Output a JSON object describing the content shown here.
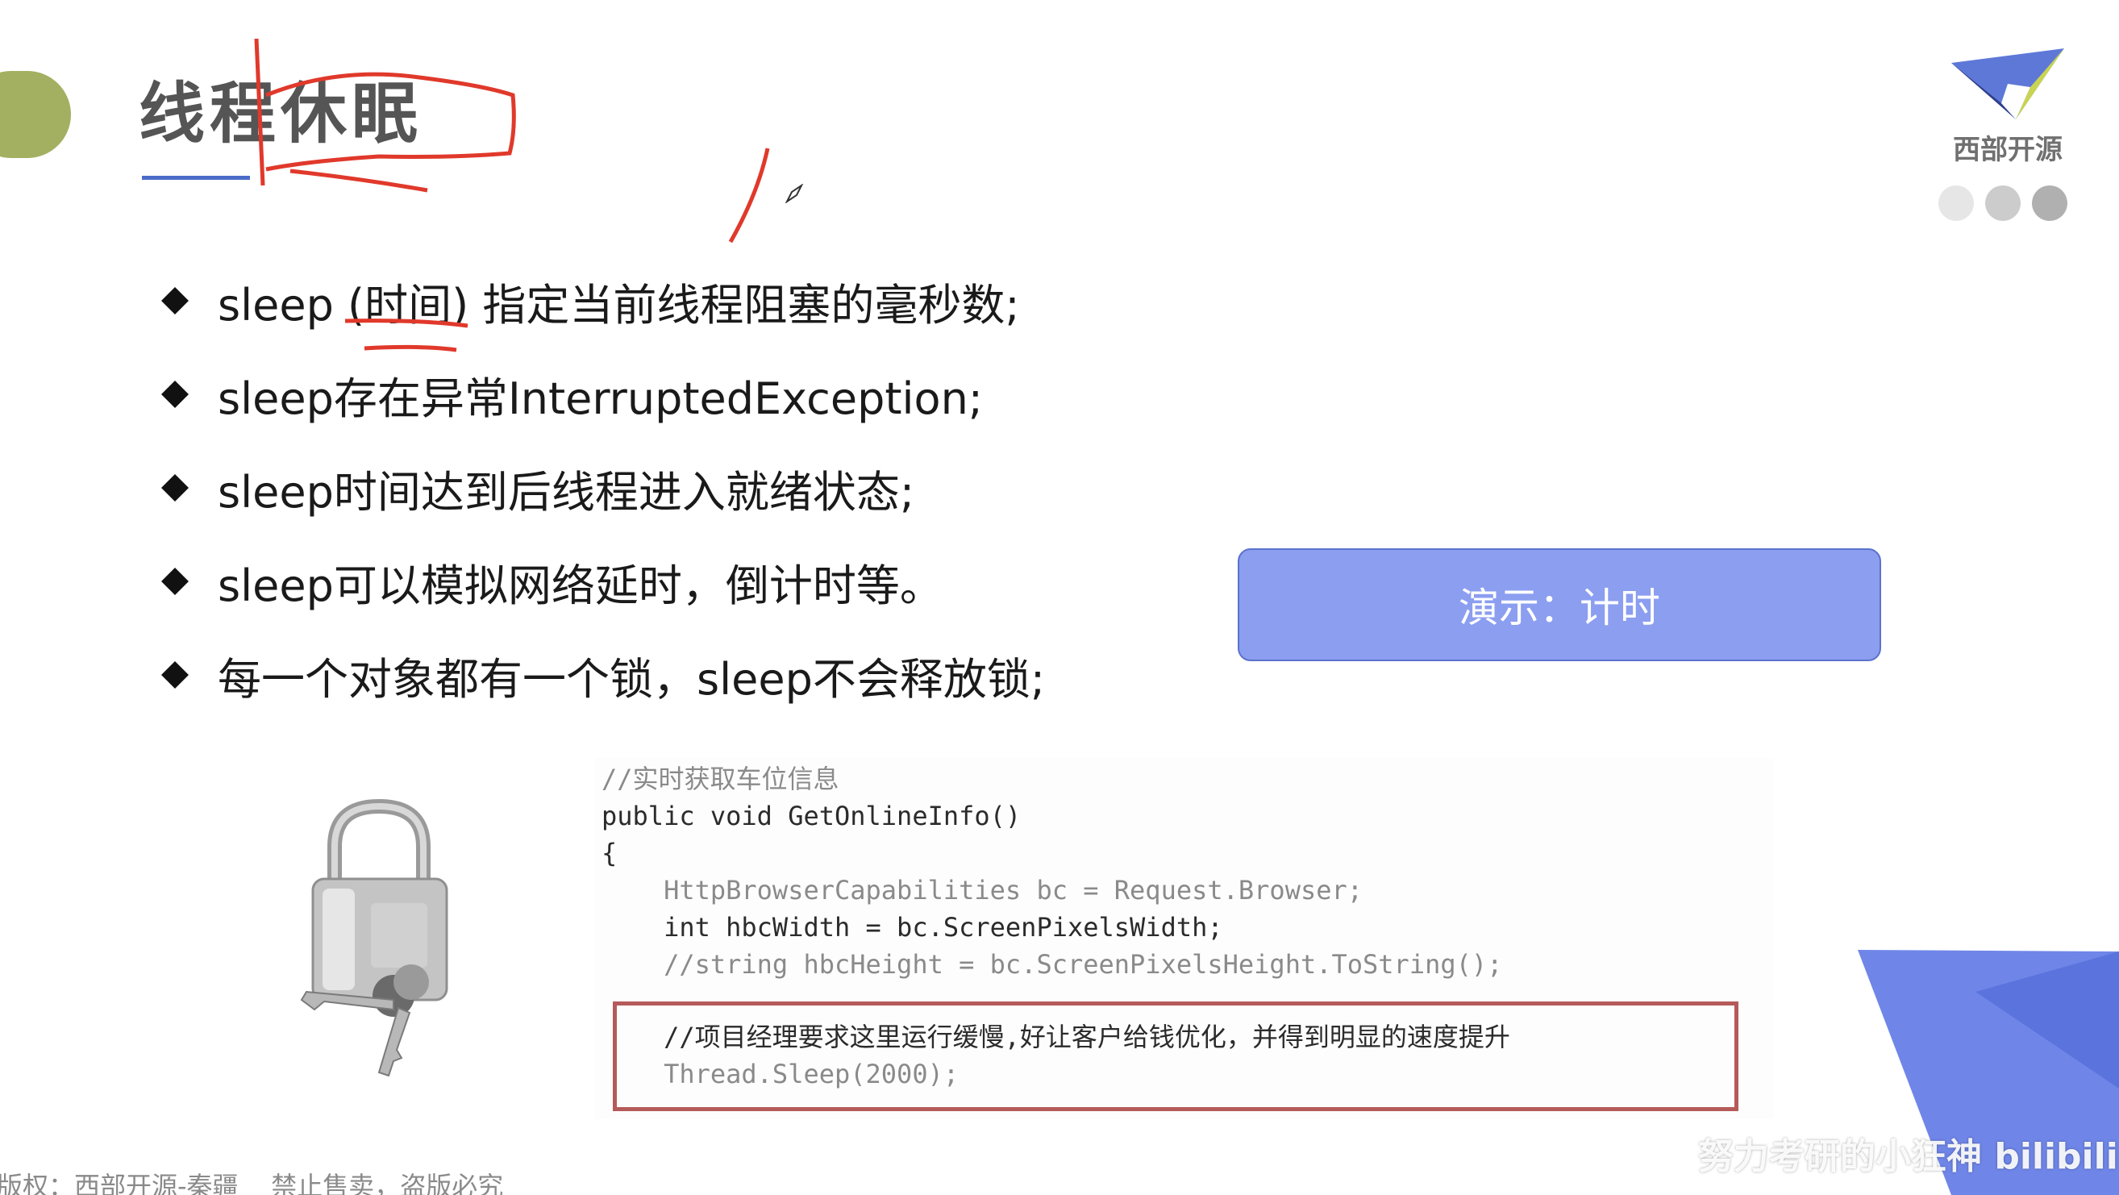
{
  "slide": {
    "title": "线程休眠",
    "logo_text": "西部开源",
    "bullets": [
      "sleep (时间) 指定当前线程阻塞的毫秒数;",
      "sleep存在异常InterruptedException;",
      "sleep时间达到后线程进入就绪状态;",
      "sleep可以模拟网络延时，倒计时等。",
      "每一个对象都有一个锁，sleep不会释放锁;"
    ],
    "demo_button_label": "演示：计时",
    "code_lines": [
      "//实时获取车位信息",
      "public void GetOnlineInfo()",
      "{",
      "    HttpBrowserCapabilities bc = Request.Browser;",
      "    int hbcWidth = bc.ScreenPixelsWidth;",
      "    //string hbcHeight = bc.ScreenPixelsHeight.ToString();",
      "    //项目经理要求这里运行缓慢,好让客户给钱优化，并得到明显的速度提升",
      "    Thread.Sleep(2000);"
    ],
    "footer_copyright": "版权：西部开源-秦疆    禁止售卖，盗版必究",
    "watermark": "努力考研的小狂神 bilibili"
  },
  "colors": {
    "accent_green": "#a3b061",
    "accent_blue": "#4a6cc8",
    "button_fill": "#8b9ef0",
    "corner_blue": "#6f86e8",
    "annotation_red": "#e0392b",
    "code_highlight_border": "#b55a5a",
    "dot_1": "#e6e6e6",
    "dot_2": "#cccccc",
    "dot_3": "#b0b0b0"
  },
  "icons": {
    "bullet": "diamond-icon",
    "logo": "western-open-source-logo",
    "lock": "padlock-with-keys-image",
    "cursor": "pen-cursor-icon"
  }
}
